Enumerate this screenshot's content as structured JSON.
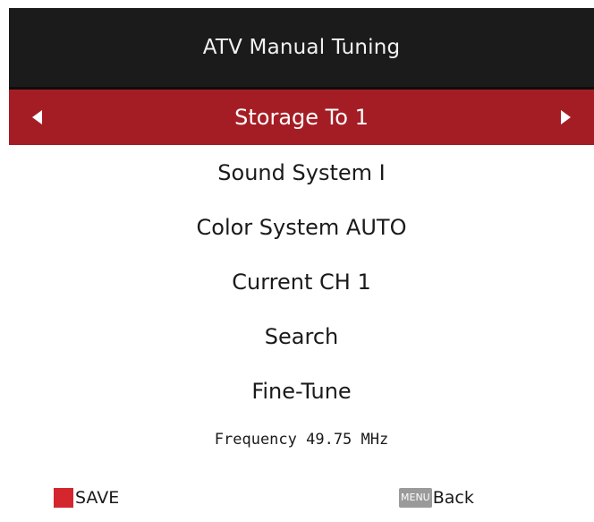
{
  "header": {
    "title": "ATV Manual Tuning"
  },
  "menu": {
    "items": [
      {
        "label": "Storage To 1"
      },
      {
        "label": "Sound System I"
      },
      {
        "label": "Color System AUTO"
      },
      {
        "label": "Current CH 1"
      },
      {
        "label": "Search"
      },
      {
        "label": "Fine-Tune"
      }
    ]
  },
  "frequency": {
    "text": "Frequency  49.75 MHz"
  },
  "footer": {
    "save_label": "SAVE",
    "menu_key_label": "MENU",
    "back_label": "Back",
    "save_key_color": "#d4262d"
  },
  "colors": {
    "header_bg": "#1b1b1b",
    "selected_bg": "#a51d24"
  }
}
